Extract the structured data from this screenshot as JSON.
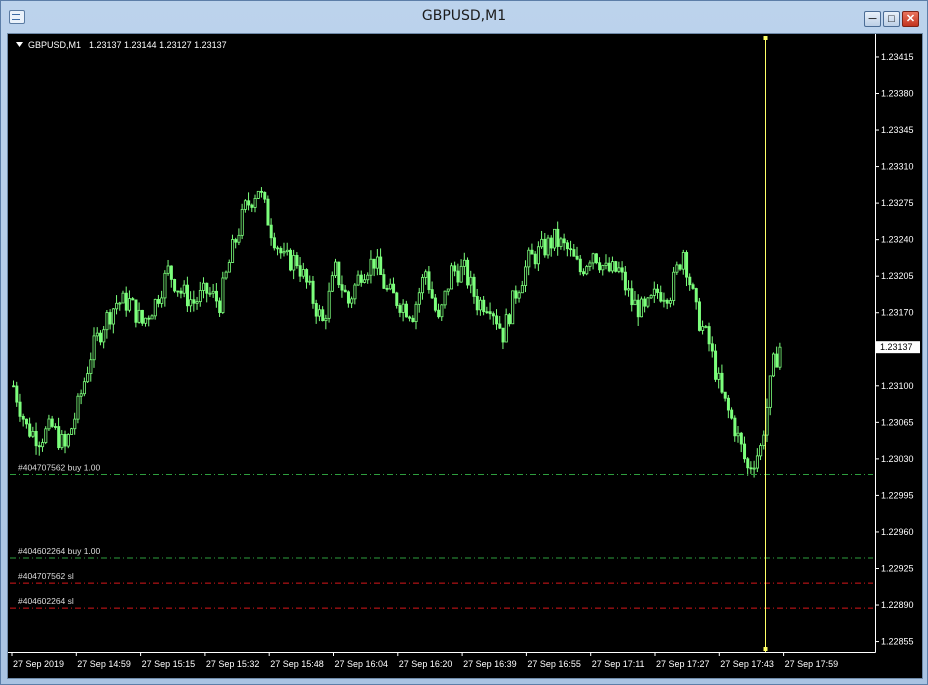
{
  "window": {
    "title": "GBPUSD,M1"
  },
  "header": {
    "symbol": "GBPUSD,M1",
    "ohlc": "1.23137 1.23144 1.23127 1.23137"
  },
  "chart_data": {
    "type": "candlestick",
    "symbol": "GBPUSD",
    "timeframe": "M1",
    "ylim": [
      1.22845,
      1.23437
    ],
    "y_ticks": [
      1.23415,
      1.2338,
      1.23345,
      1.2331,
      1.23275,
      1.2324,
      1.23205,
      1.2317,
      1.23135,
      1.231,
      1.23065,
      1.2303,
      1.22995,
      1.2296,
      1.22925,
      1.2289,
      1.22855
    ],
    "y_tick_labels": [
      "1.23415",
      "1.23380",
      "1.23345",
      "1.23310",
      "1.23275",
      "1.23240",
      "1.23205",
      "1.23170",
      "1.23135",
      "1.23100",
      "1.23065",
      "1.23030",
      "1.22995",
      "1.22960",
      "1.22925",
      "1.22890",
      "1.22855"
    ],
    "current_price": 1.23137,
    "current_price_label": "1.23137",
    "x_labels": [
      "27 Sep 2019",
      "27 Sep 14:59",
      "27 Sep 15:15",
      "27 Sep 15:32",
      "27 Sep 15:48",
      "27 Sep 16:04",
      "27 Sep 16:20",
      "27 Sep 16:39",
      "27 Sep 16:55",
      "27 Sep 17:11",
      "27 Sep 17:27",
      "27 Sep 17:43",
      "27 Sep 17:59"
    ],
    "close_path": [
      [
        0,
        1.231
      ],
      [
        4,
        1.2306
      ],
      [
        8,
        1.2305
      ],
      [
        12,
        1.2306
      ],
      [
        16,
        1.2304
      ],
      [
        20,
        1.2308
      ],
      [
        24,
        1.2313
      ],
      [
        28,
        1.2316
      ],
      [
        32,
        1.2318
      ],
      [
        36,
        1.2318
      ],
      [
        40,
        1.2316
      ],
      [
        44,
        1.2318
      ],
      [
        48,
        1.2321
      ],
      [
        52,
        1.2319
      ],
      [
        56,
        1.2318
      ],
      [
        60,
        1.2319
      ],
      [
        64,
        1.2318
      ],
      [
        68,
        1.2323
      ],
      [
        72,
        1.2327
      ],
      [
        76,
        1.2329
      ],
      [
        80,
        1.2325
      ],
      [
        84,
        1.2322
      ],
      [
        88,
        1.2322
      ],
      [
        92,
        1.2319
      ],
      [
        96,
        1.2316
      ],
      [
        100,
        1.2321
      ],
      [
        104,
        1.2318
      ],
      [
        108,
        1.2321
      ],
      [
        112,
        1.2322
      ],
      [
        116,
        1.2319
      ],
      [
        120,
        1.2318
      ],
      [
        124,
        1.2317
      ],
      [
        128,
        1.2321
      ],
      [
        132,
        1.2316
      ],
      [
        136,
        1.2321
      ],
      [
        140,
        1.2321
      ],
      [
        144,
        1.2318
      ],
      [
        148,
        1.2318
      ],
      [
        152,
        1.2315
      ],
      [
        156,
        1.2319
      ],
      [
        160,
        1.2322
      ],
      [
        164,
        1.2323
      ],
      [
        168,
        1.2324
      ],
      [
        172,
        1.2323
      ],
      [
        176,
        1.2321
      ],
      [
        180,
        1.2323
      ],
      [
        184,
        1.2321
      ],
      [
        188,
        1.2321
      ],
      [
        192,
        1.2318
      ],
      [
        196,
        1.2317
      ],
      [
        200,
        1.2319
      ],
      [
        204,
        1.2319
      ],
      [
        208,
        1.2323
      ],
      [
        212,
        1.2317
      ],
      [
        216,
        1.2314
      ],
      [
        220,
        1.2309
      ],
      [
        224,
        1.2306
      ],
      [
        228,
        1.2302
      ],
      [
        232,
        1.2304
      ],
      [
        236,
        1.2312
      ],
      [
        238,
        1.23137
      ]
    ],
    "cursor_time": "27 Sep 17:46",
    "orders": [
      {
        "label": "#404707562 buy 1.00",
        "price": 1.23015,
        "kind": "buy"
      },
      {
        "label": "#404602264 buy 1.00",
        "price": 1.22935,
        "kind": "buy"
      },
      {
        "label": "#404707562 sl",
        "price": 1.22911,
        "kind": "sl"
      },
      {
        "label": "#404602264 sl",
        "price": 1.22887,
        "kind": "sl"
      }
    ],
    "colors": {
      "background": "#000000",
      "candle": "#7cff7c",
      "buy_line": "#2e9e3e",
      "sl_line": "#d8171b",
      "cursor": "#ffff66",
      "axis_text": "#ffffff"
    }
  }
}
